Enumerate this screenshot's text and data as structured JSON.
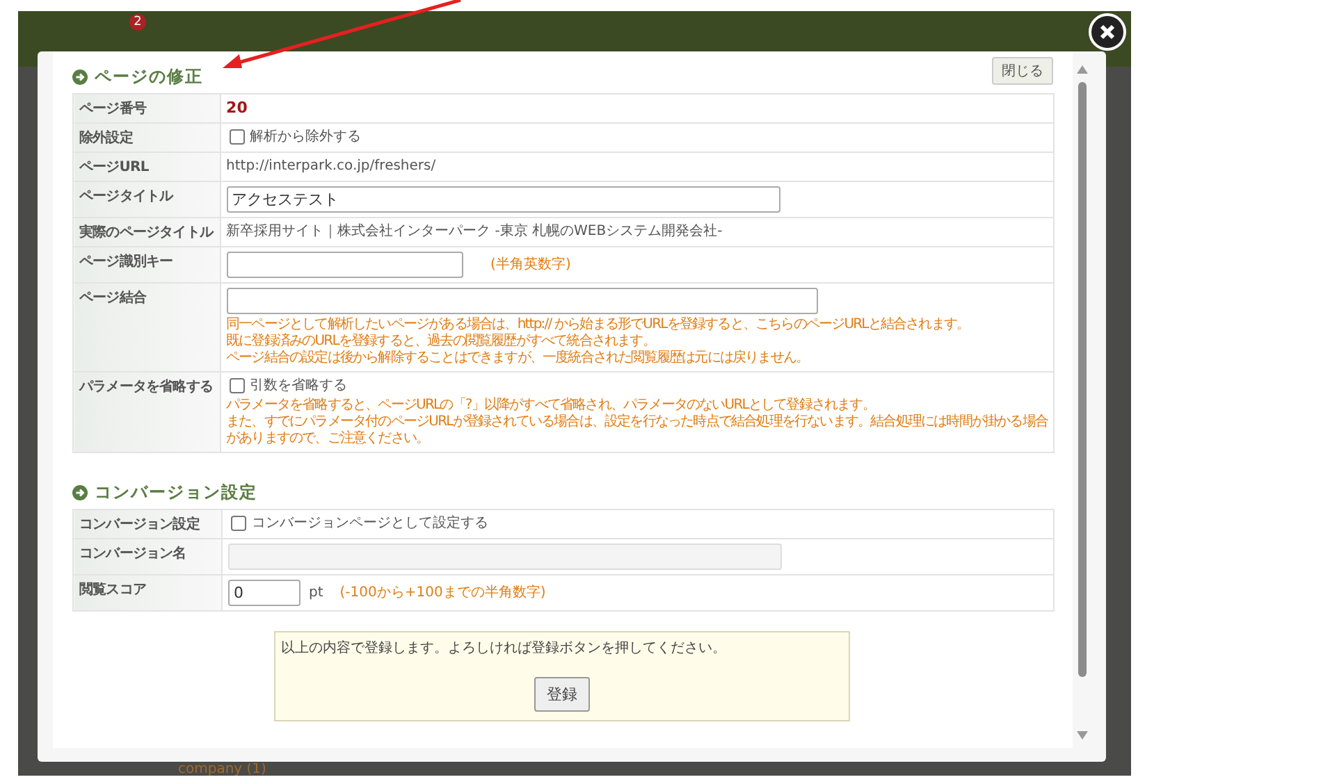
{
  "background": {
    "notification_count": "2",
    "tree_item": "company (1)"
  },
  "dialog": {
    "close_button": "閉じる",
    "sections": [
      {
        "title": "ページの修正",
        "rows": [
          {
            "kind": "number",
            "label": "ページ番号",
            "value": "20"
          },
          {
            "kind": "checkbox",
            "label": "除外設定",
            "option": "解析から除外する",
            "checked": false
          },
          {
            "kind": "text",
            "label": "ページURL",
            "value": "http://interpark.co.jp/freshers/"
          },
          {
            "kind": "input",
            "label": "ページタイトル",
            "value": "アクセステスト",
            "disabled": false
          },
          {
            "kind": "text",
            "label": "実際のページタイトル",
            "value": "新卒採用サイト｜株式会社インターパーク -東京 札幌のWEBシステム開発会社-"
          },
          {
            "kind": "input",
            "label": "ページ識別キー",
            "hint": "(半角英数字)",
            "disabled": false
          },
          {
            "kind": "input",
            "label": "ページ結合",
            "disabled": false,
            "notes": [
              "同一ページとして解析したいページがある場合は、http:// から始まる形でURLを登録すると、こちらのページURLと結合されます。",
              "既に登録済みのURLを登録すると、過去の閲覧履歴がすべて統合されます。",
              "ページ結合の設定は後から解除することはできますが、一度統合された閲覧履歴は元には戻りません。"
            ]
          },
          {
            "kind": "checkbox",
            "label": "パラメータを省略する",
            "option": "引数を省略する",
            "checked": false,
            "notes": [
              "パラメータを省略すると、ページURLの「?」以降がすべて省略され、パラメータのないURLとして登録されます。",
              "また、すでにパラメータ付のページURLが登録されている場合は、設定を行なった時点で結合処理を行ないます。結合処理には時間が掛かる場合",
              "がありますので、ご注意ください。"
            ]
          }
        ]
      },
      {
        "title": "コンバージョン設定",
        "rows": [
          {
            "kind": "checkbox",
            "label": "コンバージョン設定",
            "option": "コンバージョンページとして設定する",
            "checked": false
          },
          {
            "kind": "input",
            "label": "コンバージョン名",
            "disabled": true
          },
          {
            "kind": "input",
            "label": "閲覧スコア",
            "value": "0",
            "unit": "pt",
            "hint": "(-100から+100までの半角数字)",
            "disabled": false
          }
        ]
      }
    ],
    "confirm": {
      "message": "以上の内容で登録します。よろしければ登録ボタンを押してください。",
      "button": "登録"
    }
  }
}
